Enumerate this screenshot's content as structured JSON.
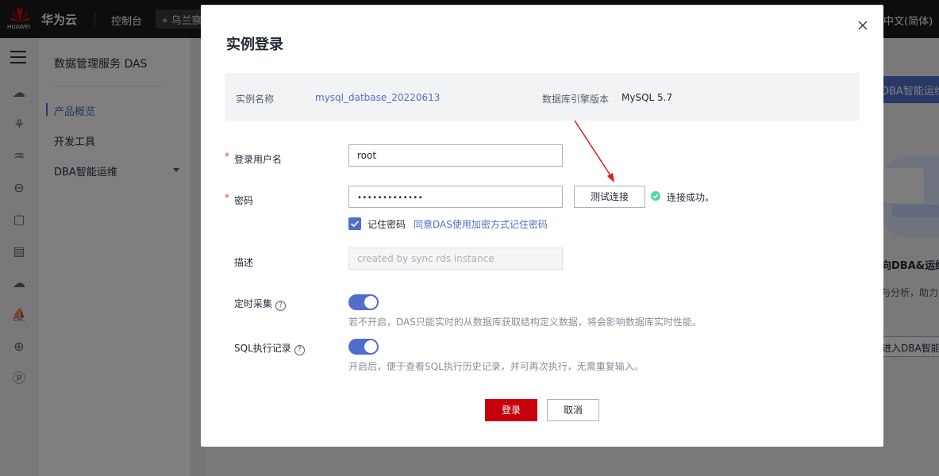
{
  "header": {
    "logo_text": "HUAWEI",
    "brand": "华为云",
    "console_label": "控制台",
    "region": "乌兰察布",
    "language": "中文(简体)"
  },
  "sidebar": {
    "service_title": "数据管理服务 DAS",
    "items": [
      {
        "label": "产品概览",
        "active": true
      },
      {
        "label": "开发工具",
        "active": false
      },
      {
        "label": "DBA智能运维",
        "active": false
      }
    ]
  },
  "background": {
    "banner_button": "DBA智能运维",
    "heading": "向DBA&运维",
    "text": "与分析，助力",
    "button": "进入DBA智能运"
  },
  "modal": {
    "title": "实例登录",
    "instance_name_label": "实例名称",
    "instance_name": "mysql_datbase_20220613",
    "engine_version_label": "数据库引擎版本",
    "engine_version": "MySQL 5.7",
    "required_mark": "*",
    "username_label": "登录用户名",
    "username_value": "root",
    "password_label": "密码",
    "password_value": "•••••••••••••",
    "test_button": "测试连接",
    "connection_status": "连接成功。",
    "remember_label": "记住密码",
    "remember_checked": true,
    "remember_link": "同意DAS使用加密方式记住密码",
    "description_label": "描述",
    "description_placeholder": "created by sync rds instance",
    "scheduled_collect_label": "定时采集",
    "scheduled_collect_on": true,
    "scheduled_collect_hint": "若不开启，DAS只能实时的从数据库获取结构定义数据，将会影响数据库实时性能。",
    "sql_log_label": "SQL执行记录",
    "sql_log_on": true,
    "sql_log_hint": "开启后，便于查看SQL执行历史记录，并可再次执行，无需重复输入。",
    "login_button": "登录",
    "cancel_button": "取消"
  },
  "colors": {
    "accent": "#526ecc",
    "brand_red": "#c7000b",
    "success": "#50d4ab",
    "annotation_arrow": "#e8171c"
  }
}
